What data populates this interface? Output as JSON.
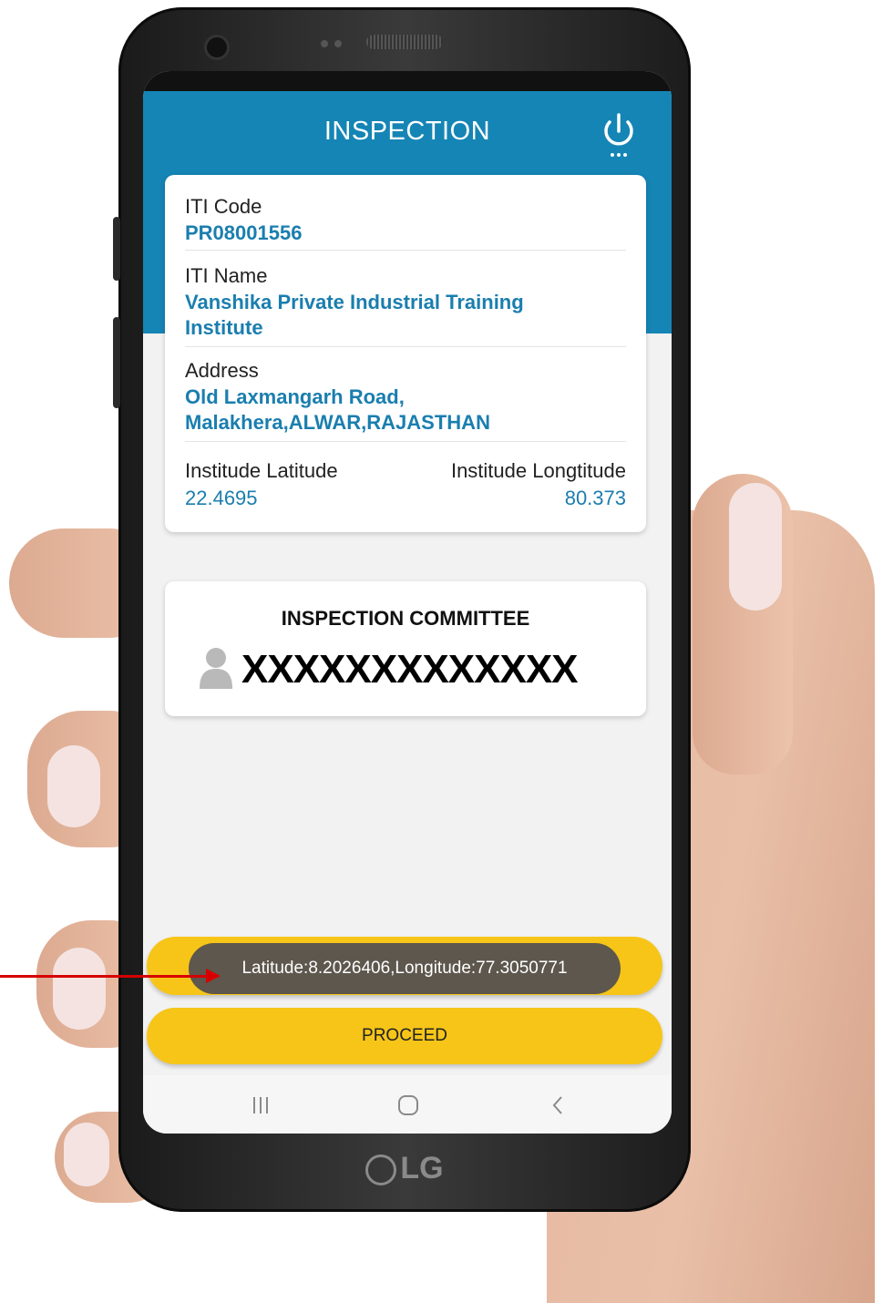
{
  "header": {
    "title": "INSPECTION",
    "power_icon": "power-icon"
  },
  "institute": {
    "code_label": "ITI Code",
    "code_value": "PR08001556",
    "name_label": "ITI Name",
    "name_value": "Vanshika Private Industrial Training Institute",
    "address_label": "Address",
    "address_value": "Old Laxmangarh Road, Malakhera,ALWAR,RAJASTHAN",
    "latitude_label": "Institude Latitude",
    "latitude_value": "22.4695",
    "longitude_label": "Institude Longtitude",
    "longitude_value": "80.373"
  },
  "committee": {
    "title": "INSPECTION COMMITTEE",
    "member_name": "XXXXXXXXXXXXX"
  },
  "toast": {
    "text": "Latitude:8.2026406,Longitude:77.3050771"
  },
  "actions": {
    "proceed_label": "PROCEED"
  },
  "brand": {
    "logo_text": "LG"
  },
  "colors": {
    "header": "#1585b5",
    "value_text": "#1a7eaf",
    "button": "#f6c518",
    "toast_bg": "#5d574d",
    "annotation_arrow": "#d60000"
  }
}
